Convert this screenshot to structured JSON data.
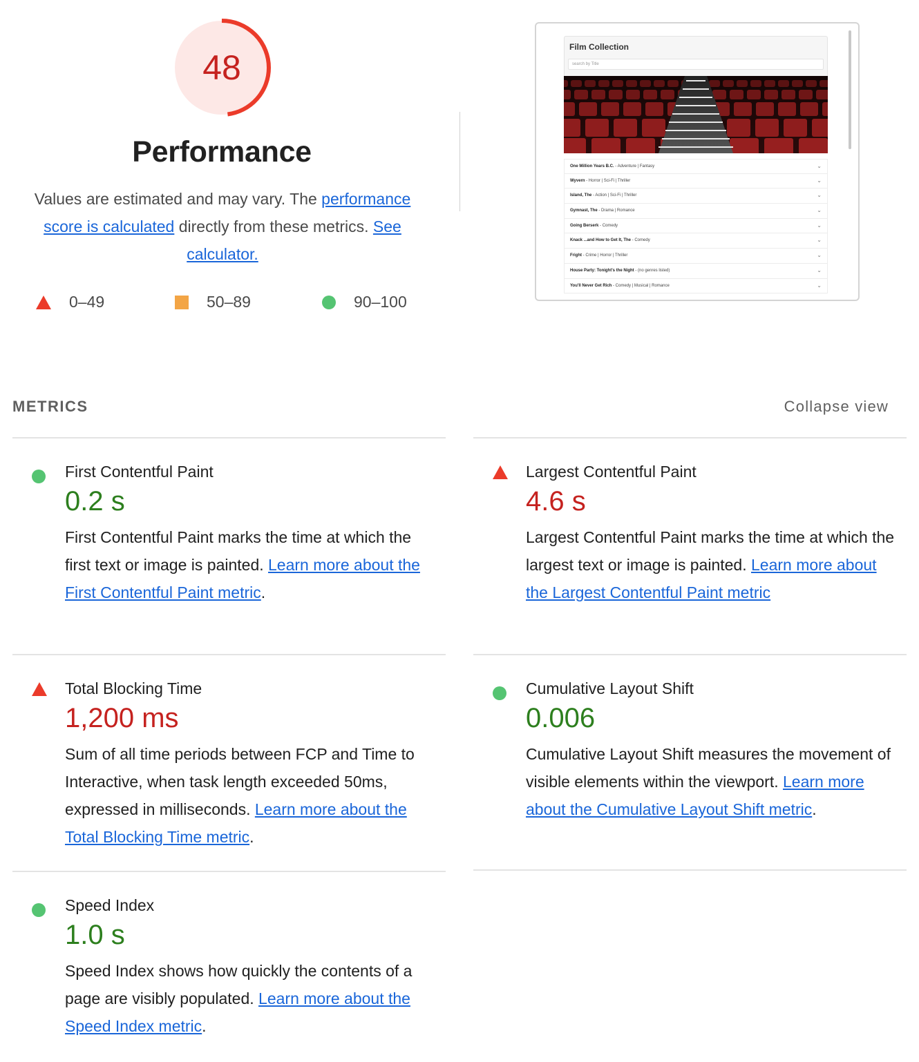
{
  "score": {
    "value": "48",
    "fraction": 0.48,
    "color_fill": "#fde8e6",
    "color_arc": "#eb3b2a",
    "color_text": "#c5221f"
  },
  "performance": {
    "title": "Performance",
    "desc_1": "Values are estimated and may vary. The ",
    "link_score": "performance score is calculated",
    "desc_2": " directly from these metrics. ",
    "link_calculator": "See calculator."
  },
  "legend": [
    {
      "icon": "fail-triangle-icon",
      "label": "0–49",
      "color": "#eb3b2a"
    },
    {
      "icon": "average-square-icon",
      "label": "50–89",
      "color": "#f3a545"
    },
    {
      "icon": "pass-circle-icon",
      "label": "90–100",
      "color": "#55c472"
    }
  ],
  "screenshot": {
    "title": "Film Collection",
    "search_placeholder": "search by Title",
    "films": [
      {
        "name": "One Million Years B.C.",
        "genres": " - Adventure | Fantasy"
      },
      {
        "name": "Wyvern",
        "genres": " - Horror | Sci-Fi | Thriller"
      },
      {
        "name": "Island, The",
        "genres": " - Action | Sci-Fi | Thriller"
      },
      {
        "name": "Gymnast, The",
        "genres": " - Drama | Romance"
      },
      {
        "name": "Going Berserk",
        "genres": " - Comedy"
      },
      {
        "name": "Knack ...and How to Get It, The",
        "genres": " - Comedy"
      },
      {
        "name": "Fright",
        "genres": " - Crime | Horror | Thriller"
      },
      {
        "name": "House Party: Tonight's the Night",
        "genres": " - (no genres listed)"
      },
      {
        "name": "You'll Never Get Rich",
        "genres": " - Comedy | Musical | Romance"
      }
    ]
  },
  "metrics_section": {
    "label": "METRICS",
    "collapse_label": "Collapse view"
  },
  "metrics": {
    "fcp": {
      "status": "pass",
      "title": "First Contentful Paint",
      "value": "0.2 s",
      "desc": "First Contentful Paint marks the time at which the first text or image is painted. ",
      "link": "Learn more about the First Contentful Paint metric",
      "suffix": "."
    },
    "lcp": {
      "status": "fail",
      "title": "Largest Contentful Paint",
      "value": "4.6 s",
      "desc": "Largest Contentful Paint marks the time at which the largest text or image is painted. ",
      "link": "Learn more about the Largest Contentful Paint metric",
      "suffix": ""
    },
    "tbt": {
      "status": "fail",
      "title": "Total Blocking Time",
      "value": "1,200 ms",
      "desc": "Sum of all time periods between FCP and Time to Interactive, when task length exceeded 50ms, expressed in milliseconds. ",
      "link": "Learn more about the Total Blocking Time metric",
      "suffix": "."
    },
    "cls": {
      "status": "pass",
      "title": "Cumulative Layout Shift",
      "value": "0.006",
      "desc": "Cumulative Layout Shift measures the movement of visible elements within the viewport. ",
      "link": "Learn more about the Cumulative Layout Shift metric",
      "suffix": "."
    },
    "si": {
      "status": "pass",
      "title": "Speed Index",
      "value": "1.0 s",
      "desc": "Speed Index shows how quickly the contents of a page are visibly populated. ",
      "link": "Learn more about the Speed Index metric",
      "suffix": "."
    }
  }
}
